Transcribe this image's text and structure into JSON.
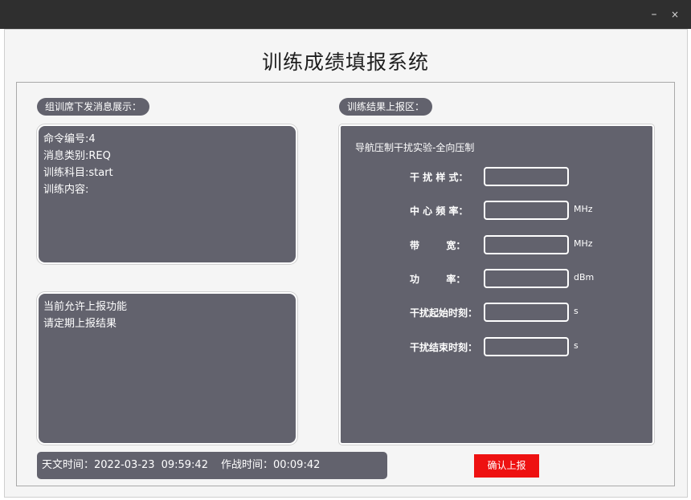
{
  "window": {
    "minimize_glyph": "–",
    "close_glyph": "×"
  },
  "app_title": "训练成绩填报系统",
  "left_section": {
    "label": "组训席下发消息展示：",
    "message": [
      "命令编号:4",
      "消息类别:REQ",
      "训练科目:start",
      "训练内容:"
    ],
    "status": [
      "当前允许上报功能",
      "请定期上报结果"
    ]
  },
  "right_section": {
    "label": "训练结果上报区：",
    "experiment_title": "导航压制干扰实验-全向压制",
    "fields": [
      {
        "label": "干 扰 样 式：",
        "value": "",
        "unit": ""
      },
      {
        "label": "中 心 频 率：",
        "value": "",
        "unit": "MHz"
      },
      {
        "label": "带        宽：",
        "value": "",
        "unit": "MHz"
      },
      {
        "label": "功        率：",
        "value": "",
        "unit": "dBm"
      },
      {
        "label": "干扰起始时刻：",
        "value": "",
        "unit": "s"
      },
      {
        "label": "干扰结束时刻：",
        "value": "",
        "unit": "s"
      }
    ]
  },
  "time_bar": {
    "astro_label": "天文时间：",
    "date": "2022-03-23",
    "time": "09:59:42",
    "combat_label": "作战时间：",
    "combat_time": "00:09:42"
  },
  "confirm_button": "确认上报"
}
